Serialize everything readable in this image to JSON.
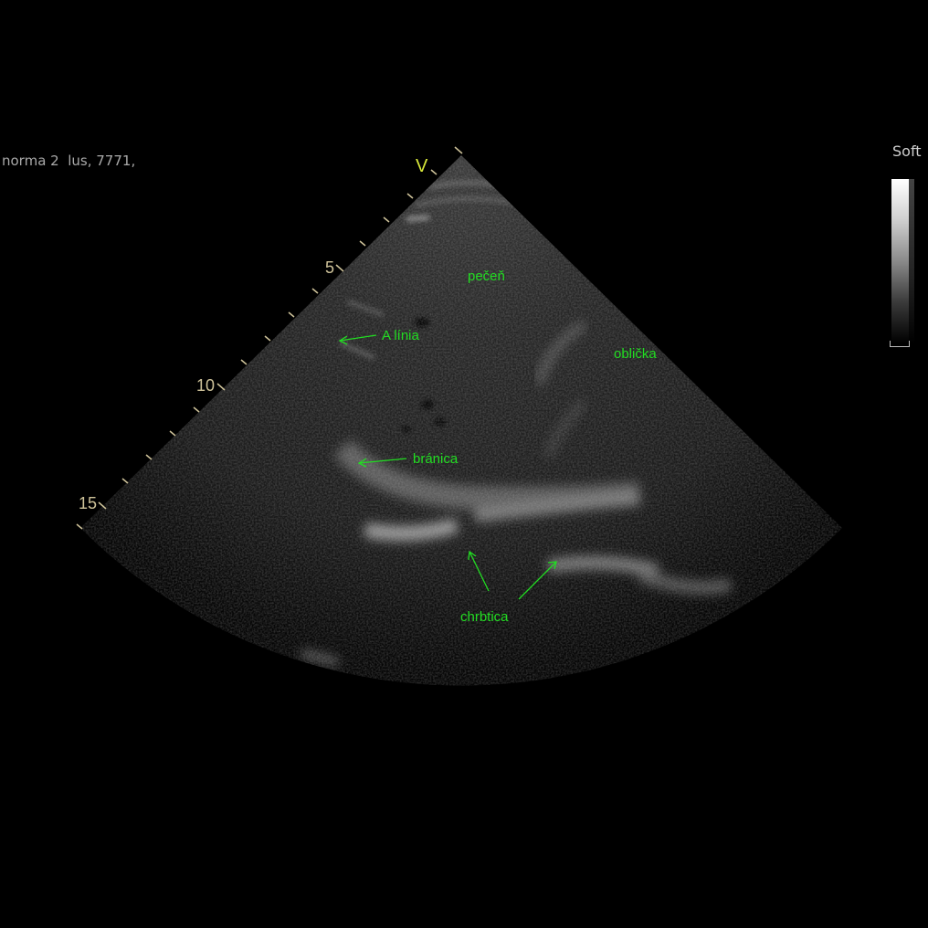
{
  "study_label": "norma 2  lus, 7771,",
  "preset": "Soft",
  "orientation_marker": "V",
  "depth_scale": [
    "5",
    "10",
    "15"
  ],
  "annotations": {
    "pecen": "pečeň",
    "oblicka": "oblička",
    "a_linia": "A línia",
    "branica": "bránica",
    "chrbtica": "chrbtica"
  },
  "colors": {
    "annotation": "#22dd22",
    "scale": "#cfc39a",
    "marker": "#d8e83a"
  }
}
